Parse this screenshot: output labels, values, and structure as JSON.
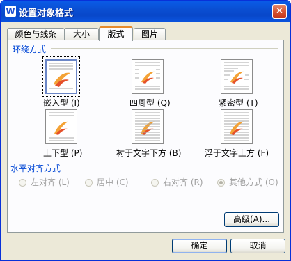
{
  "window": {
    "title": "设置对象格式",
    "app_icon": "W"
  },
  "tabs": [
    "颜色与线条",
    "大小",
    "版式",
    "图片"
  ],
  "active_tab": 2,
  "wrap_section": {
    "title": "环绕方式",
    "options": [
      {
        "label": "嵌入型 (I)",
        "icon": "inline-wrap-icon",
        "selected": true
      },
      {
        "label": "四周型 (Q)",
        "icon": "square-wrap-icon",
        "selected": false
      },
      {
        "label": "紧密型 (T)",
        "icon": "tight-wrap-icon",
        "selected": false
      },
      {
        "label": "上下型 (P)",
        "icon": "top-bottom-wrap-icon",
        "selected": false
      },
      {
        "label": "衬于文字下方 (B)",
        "icon": "behind-text-icon",
        "selected": false
      },
      {
        "label": "浮于文字上方 (F)",
        "icon": "in-front-of-text-icon",
        "selected": false
      }
    ]
  },
  "align_section": {
    "title": "水平对齐方式",
    "options": [
      {
        "label": "左对齐 (L)",
        "checked": false
      },
      {
        "label": "居中 (C)",
        "checked": false
      },
      {
        "label": "右对齐 (R)",
        "checked": false
      },
      {
        "label": "其他方式 (O)",
        "checked": true
      }
    ]
  },
  "buttons": {
    "advanced": "高级(A)...",
    "ok": "确定",
    "cancel": "取消"
  },
  "colors": {
    "title_bar": "#0a53dd",
    "group_title": "#0046d5",
    "tab_highlight": "#e68b2c"
  }
}
